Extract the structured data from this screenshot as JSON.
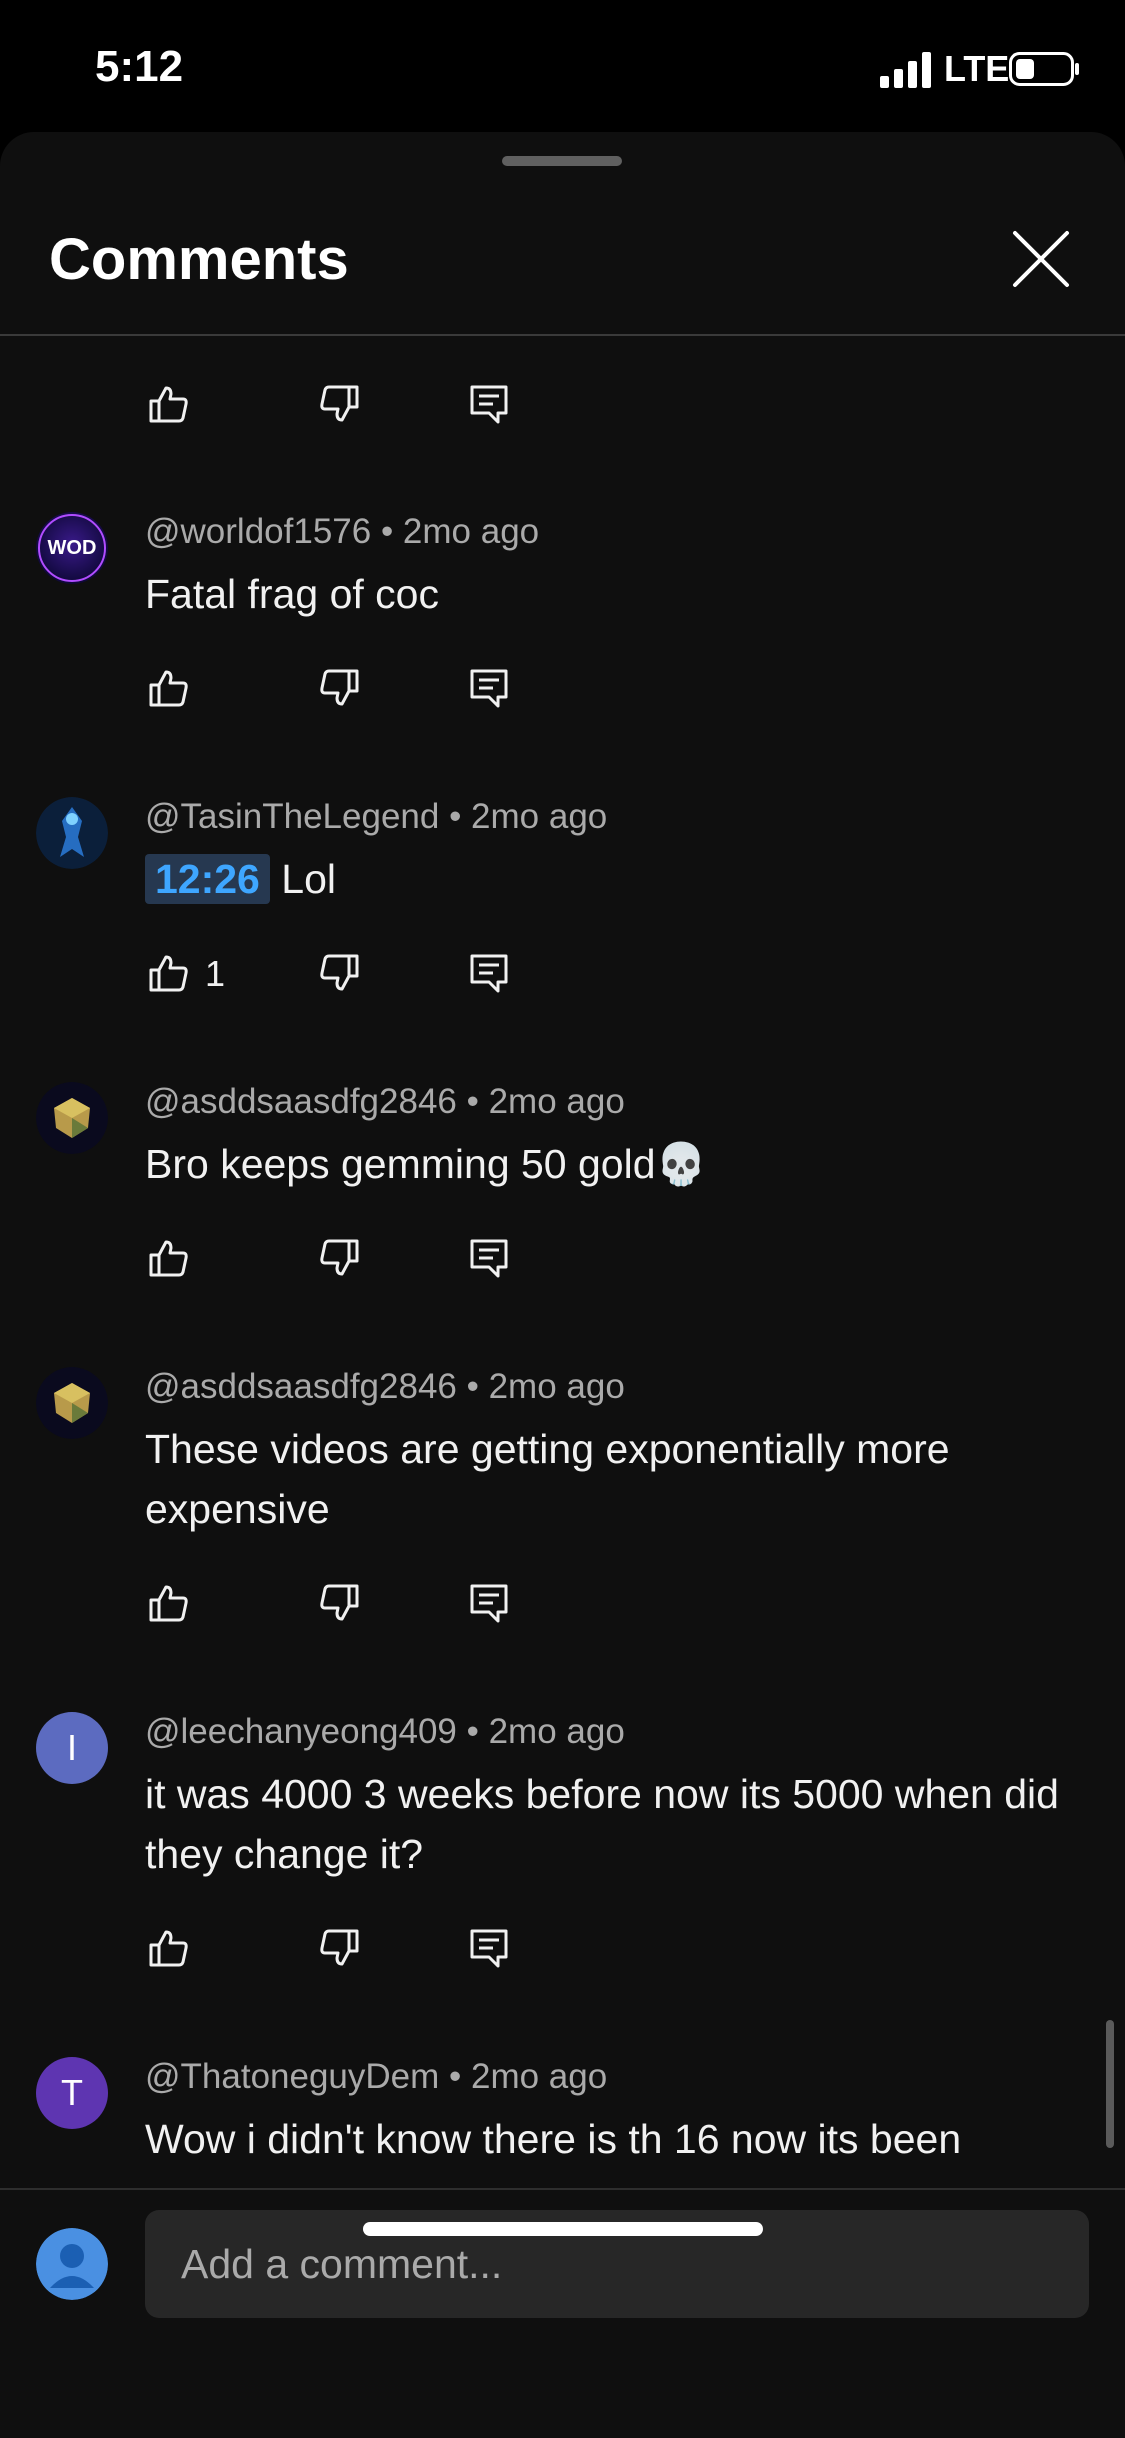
{
  "status_bar": {
    "time": "5:12",
    "network": "LTE"
  },
  "header": {
    "title": "Comments"
  },
  "comments": [
    {
      "handle": "@worldof1576",
      "age": "2mo ago",
      "text": "Fatal frag of coc",
      "likes": ""
    },
    {
      "handle": "@TasinTheLegend",
      "age": "2mo ago",
      "timestamp": "12:26",
      "text": "Lol",
      "likes": "1"
    },
    {
      "handle": "@asddsaasdfg2846",
      "age": "2mo ago",
      "text": "Bro keeps gemming 50 gold💀",
      "likes": ""
    },
    {
      "handle": "@asddsaasdfg2846",
      "age": "2mo ago",
      "text": "These videos are getting exponentially more expensive",
      "likes": ""
    },
    {
      "handle": "@leechanyeong409",
      "age": "2mo ago",
      "text": "it was 4000 3 weeks before now its 5000 when did they change it?",
      "likes": "",
      "avatar_letter": "I"
    },
    {
      "handle": "@ThatoneguyDem",
      "age": "2mo ago",
      "text": "Wow i didn't know there is th 16 now its been",
      "likes": "",
      "avatar_letter": "T"
    }
  ],
  "composer": {
    "placeholder": "Add a comment..."
  },
  "icons": {
    "like": "thumbs-up-icon",
    "dislike": "thumbs-down-icon",
    "reply": "reply-comment-icon",
    "close": "close-icon"
  },
  "colors": {
    "timestamp_link": "#3ea6ff",
    "avatar_I": "#5c6bc0",
    "avatar_T": "#5e35b1"
  }
}
